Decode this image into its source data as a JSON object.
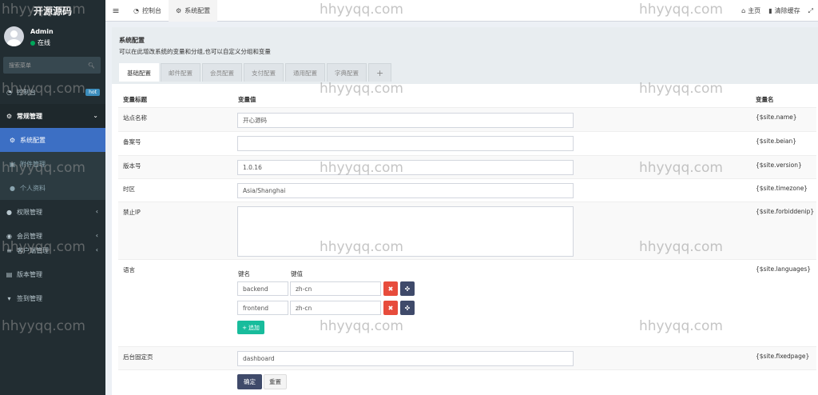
{
  "app": {
    "logo": "开源源码"
  },
  "user": {
    "name": "Admin",
    "status": "在线"
  },
  "search": {
    "placeholder": "搜索菜单"
  },
  "sidebar": {
    "items": [
      {
        "label": "控制台",
        "icon": "dashboard-icon",
        "badge": "hot"
      },
      {
        "label": "常规管理",
        "icon": "cogs-icon"
      },
      {
        "label": "系统配置",
        "icon": "gear-icon"
      },
      {
        "label": "附件管理",
        "icon": "image-icon"
      },
      {
        "label": "个人资料",
        "icon": "user-icon"
      },
      {
        "label": "权限管理",
        "icon": "group-icon"
      },
      {
        "label": "会员管理",
        "icon": "user-circle-icon"
      },
      {
        "label": "客户端管理",
        "icon": "list-icon"
      },
      {
        "label": "版本管理",
        "icon": "file-icon"
      },
      {
        "label": "签到管理",
        "icon": "map-marker-icon"
      }
    ]
  },
  "topbar": {
    "tabs": [
      {
        "label": "控制台"
      },
      {
        "label": "系统配置"
      }
    ],
    "home": "主页",
    "clear_cache": "清除缓存"
  },
  "page": {
    "title": "系统配置",
    "description": "可以在此增改系统的变量和分组,也可以自定义分组和变量",
    "tabs": [
      "基础配置",
      "邮件配置",
      "会员配置",
      "支付配置",
      "通用配置",
      "字典配置",
      "+"
    ]
  },
  "table": {
    "headers": {
      "title": "变量标题",
      "value": "变量值",
      "name": "变量名"
    },
    "rows": [
      {
        "title": "站点名称",
        "value": "开心源码",
        "name": "{$site.name}"
      },
      {
        "title": "备案号",
        "value": "",
        "name": "{$site.beian}"
      },
      {
        "title": "版本号",
        "value": "1.0.16",
        "name": "{$site.version}"
      },
      {
        "title": "时区",
        "value": "Asia/Shanghai",
        "name": "{$site.timezone}"
      },
      {
        "title": "禁止IP",
        "value": "",
        "name": "{$site.forbiddenip}"
      },
      {
        "title": "语言",
        "name": "{$site.languages}"
      },
      {
        "title": "后台固定页",
        "value": "dashboard",
        "name": "{$site.fixedpage}"
      }
    ],
    "languages": {
      "key_label": "键名",
      "value_label": "键值",
      "pairs": [
        {
          "key": "backend",
          "value": "zh-cn"
        },
        {
          "key": "frontend",
          "value": "zh-cn"
        }
      ],
      "add_label": "追加"
    }
  },
  "actions": {
    "ok": "确定",
    "reset": "重置"
  },
  "watermark": "hhyyqq.com",
  "colors": {
    "sidebar": "#222d32",
    "active": "#3c6fc4",
    "add": "#18bc9c",
    "danger": "#e74c3c",
    "dark_btn": "#3f4a6a"
  }
}
